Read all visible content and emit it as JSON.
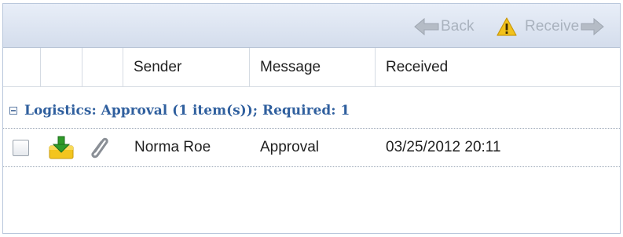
{
  "toolbar": {
    "back_label": "Back",
    "receive_label": "Receive",
    "back_icon": "arrow-left-icon",
    "warning_icon": "warning-icon",
    "forward_icon": "arrow-right-icon"
  },
  "grid": {
    "columns": [
      "",
      "",
      "",
      "Sender",
      "Message",
      "Received"
    ]
  },
  "group": {
    "label": "Logistics: Approval (1 item(s)); Required: 1",
    "expanded": true
  },
  "rows": [
    {
      "checked": false,
      "icon": "inbox-download-icon",
      "attachment_icon": "paperclip-icon",
      "sender": "Norma Roe",
      "message": "Approval",
      "received": "03/25/2012 20:11"
    }
  ],
  "colors": {
    "toolbar_bg": "#dde5f1",
    "group_text": "#2f5f9e",
    "disabled_text": "#a9b2be"
  }
}
